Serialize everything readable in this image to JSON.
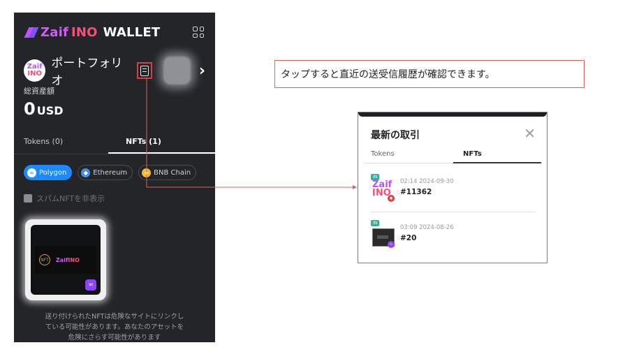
{
  "app": {
    "brand_zaif": "Zaif",
    "brand_ino": "INO",
    "brand_wallet": "WALLET",
    "menu_icon": "grid-icon"
  },
  "portfolio": {
    "logo_line1": "Zaif",
    "logo_line2": "INO",
    "label": "ポートフォリオ",
    "history_icon": "receipt-icon",
    "total_label": "総資産額",
    "total_value": "0",
    "total_unit": "USD"
  },
  "tabs": {
    "tokens": "Tokens (0)",
    "nfts": "NFTs (1)"
  },
  "chains": [
    {
      "label": "Polygon",
      "icon": "polygon-icon",
      "active": true
    },
    {
      "label": "Ethereum",
      "icon": "ethereum-icon",
      "active": false
    },
    {
      "label": "BNB Chain",
      "icon": "bnb-icon",
      "active": false
    }
  ],
  "spam_toggle": "スパムNFTを非表示",
  "nft_card": {
    "art_text_brand": "Zaif",
    "art_text_ino": "INO"
  },
  "warning": {
    "line1": "送り付けられたNFTは危険なサイトにリンクし",
    "line2": "ている可能性があります。あなたのアセットを",
    "line3": "危険にさらす可能性があります"
  },
  "callout": "タップすると直近の送受信履歴が確認できます。",
  "history_panel": {
    "title": "最新の取引",
    "close": "✕",
    "tab_tokens": "Tokens",
    "tab_nfts": "NFTs",
    "transactions": [
      {
        "direction": "IN",
        "logo1": "Zaif",
        "logo2": "INO",
        "time": "02:14 2024-09-30",
        "id": "#11362"
      },
      {
        "direction": "IN",
        "time": "03:09 2024-08-26",
        "id": "#20"
      }
    ]
  },
  "colors": {
    "phone_bg": "#232529",
    "accent_blue": "#1e88ff",
    "callout_border": "#e06060",
    "highlight_red": "#e03c3c"
  }
}
